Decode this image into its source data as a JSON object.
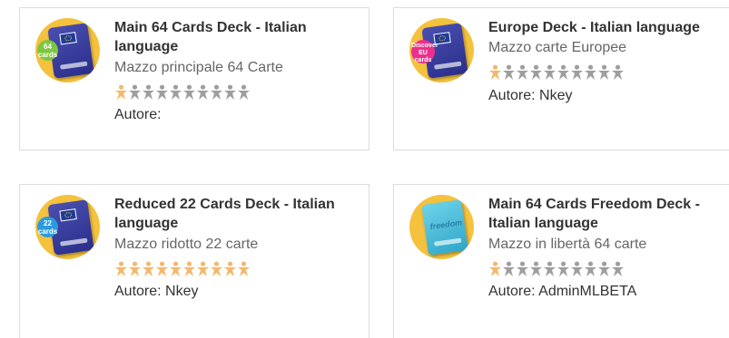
{
  "decks": [
    {
      "title": "Main 64 Cards Deck - Italian language",
      "subtitle": "Mazzo principale 64 Carte",
      "author": "Autore:",
      "rating_filled": 1,
      "rating_total": 10,
      "badge_text": "64 cards",
      "badge_color": "#7dc63f",
      "deck_color": "blue"
    },
    {
      "title": "Europe Deck - Italian language",
      "subtitle": "Mazzo carte Europee",
      "author": "Autore: Nkey",
      "rating_filled": 1,
      "rating_total": 10,
      "badge_text": "Discover EU cards",
      "badge_color": "#ec2f8c",
      "deck_color": "blue"
    },
    {
      "title": "Reduced 22 Cards Deck - Italian language",
      "subtitle": "Mazzo ridotto 22 carte",
      "author": "Autore: Nkey",
      "rating_filled": 10,
      "rating_total": 10,
      "badge_text": "22 cards",
      "badge_color": "#2b9be0",
      "deck_color": "blue"
    },
    {
      "title": "Main 64 Cards Freedom Deck - Italian language",
      "subtitle": "Mazzo in libertà 64 carte",
      "author": "Autore: AdminMLBETA",
      "rating_filled": 1,
      "rating_total": 10,
      "badge_text": "freedom",
      "badge_color": "#2c7ea8",
      "deck_color": "cyan"
    }
  ],
  "colors": {
    "star_filled": "#f5b86a",
    "star_empty": "#9e9e9e",
    "thumb_bg": "#f5c23e",
    "title": "#333333",
    "subtitle": "#666666"
  },
  "icons": {
    "rating_star": "person-star-icon"
  }
}
